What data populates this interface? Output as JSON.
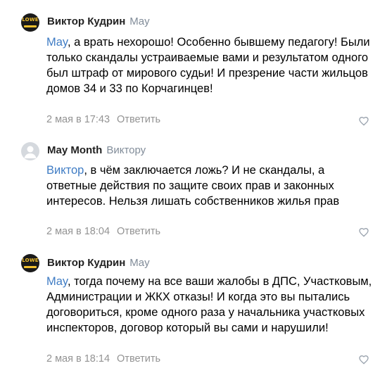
{
  "comments": [
    {
      "author": "Виктор Кудрин",
      "reply_to": "May",
      "avatar": "lowe-logo",
      "avatar_text": "LOWE",
      "mention": "May",
      "text": ", а врать нехорошо! Особенно бывшему педагогу! Были только скандалы устраиваемые вами и результатом одного был штраф от мирового судьи! И презрение части жильцов домов 34 и 33 по Корчагинцев!",
      "date": "2 мая в 17:43",
      "reply_label": "Ответить"
    },
    {
      "author": "May Month",
      "reply_to": "Виктору",
      "avatar": "default-avatar",
      "mention": "Виктор",
      "text": ", в чём заключается ложь? И не скандалы, а ответные действия по защите своих прав и законных интересов. Нельзя лишать собственников жилья прав",
      "date": "2 мая в 18:04",
      "reply_label": "Ответить"
    },
    {
      "author": "Виктор Кудрин",
      "reply_to": "May",
      "avatar": "lowe-logo",
      "avatar_text": "LOWE",
      "mention": "May",
      "text": ", тогда почему на все ваши жалобы в ДПС, Участковым, Администрации и ЖКХ отказы! И когда это вы пытались договориться, кроме одного раза у начальника участковых инспекторов, договор который вы сами и нарушили!",
      "date": "2 мая в 18:14",
      "reply_label": "Ответить"
    }
  ],
  "colors": {
    "mention": "#3f7cc4",
    "meta": "#939393",
    "reply_to": "#818c99",
    "accent_logo": "#f2c12e"
  }
}
